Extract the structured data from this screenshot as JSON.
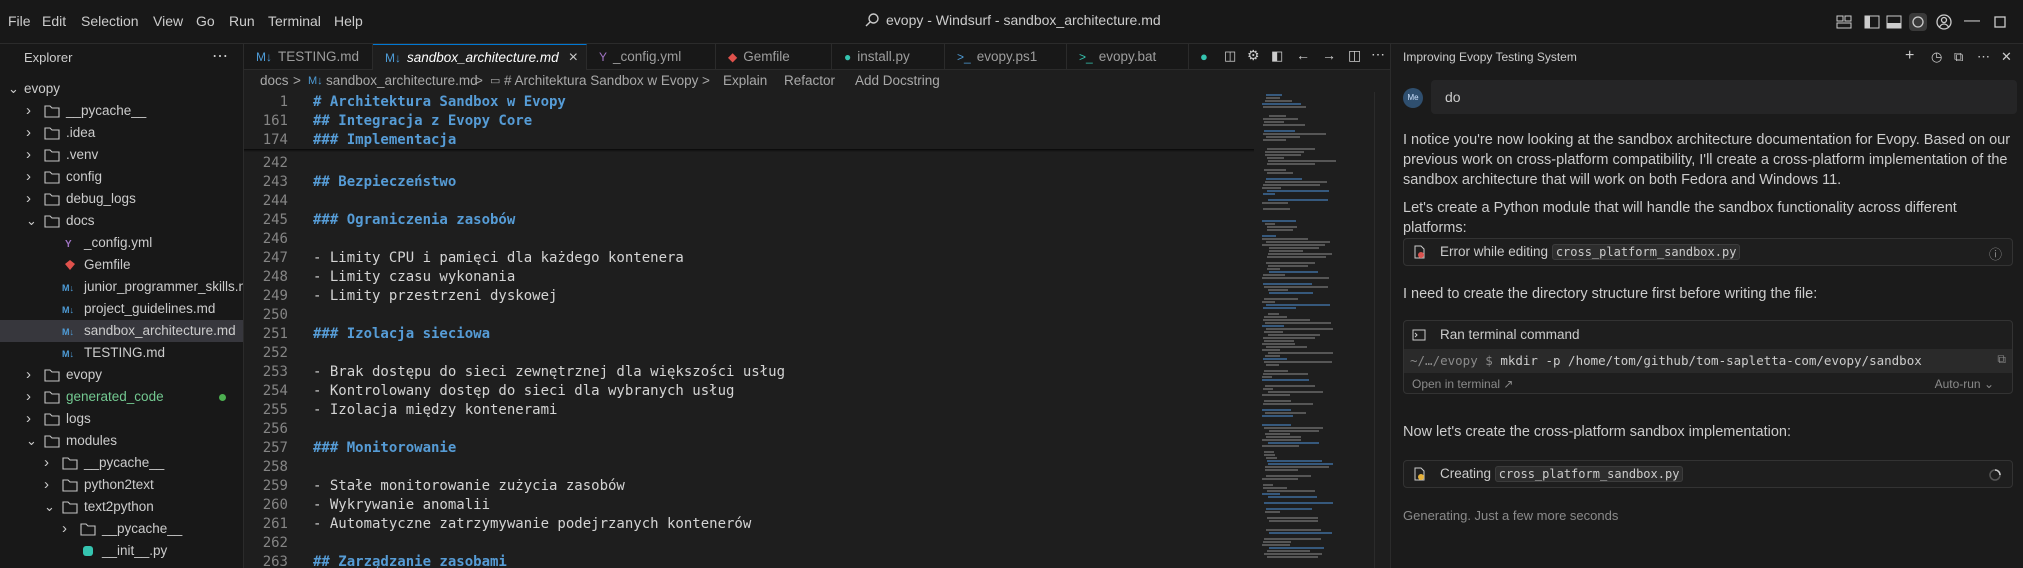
{
  "menu": [
    "File",
    "Edit",
    "Selection",
    "View",
    "Go",
    "Run",
    "Terminal",
    "Help"
  ],
  "window_title": "evopy - Windsurf - sandbox_architecture.md",
  "explorer": {
    "title": "Explorer",
    "tree": [
      {
        "label": "evopy",
        "type": "root"
      },
      {
        "label": "__pycache__",
        "type": "folder"
      },
      {
        "label": ".idea",
        "type": "folder"
      },
      {
        "label": ".venv",
        "type": "folder"
      },
      {
        "label": "config",
        "type": "folder"
      },
      {
        "label": "debug_logs",
        "type": "folder"
      },
      {
        "label": "docs",
        "type": "folder-open"
      },
      {
        "label": "_config.yml",
        "type": "yml"
      },
      {
        "label": "Gemfile",
        "type": "gem"
      },
      {
        "label": "junior_programmer_skills.md",
        "type": "md"
      },
      {
        "label": "project_guidelines.md",
        "type": "md"
      },
      {
        "label": "sandbox_architecture.md",
        "type": "md"
      },
      {
        "label": "TESTING.md",
        "type": "md"
      },
      {
        "label": "evopy",
        "type": "folder"
      },
      {
        "label": "generated_code",
        "type": "folder-green"
      },
      {
        "label": "logs",
        "type": "folder"
      },
      {
        "label": "modules",
        "type": "folder-open"
      },
      {
        "label": "__pycache__",
        "type": "folder"
      },
      {
        "label": "python2text",
        "type": "folder"
      },
      {
        "label": "text2python",
        "type": "folder-open"
      },
      {
        "label": "__pycache__",
        "type": "folder"
      },
      {
        "label": "__init__.py",
        "type": "py"
      }
    ]
  },
  "tabs": [
    {
      "label": "TESTING.md",
      "icon": "md"
    },
    {
      "label": "sandbox_architecture.md",
      "icon": "md",
      "close": "×"
    },
    {
      "label": "_config.yml",
      "icon": "yml"
    },
    {
      "label": "Gemfile",
      "icon": "gem"
    },
    {
      "label": "install.py",
      "icon": "py"
    },
    {
      "label": "evopy.ps1",
      "icon": "ps"
    },
    {
      "label": "evopy.bat",
      "icon": "bat"
    }
  ],
  "breadcrumbs": {
    "items": [
      "docs",
      "sandbox_architecture.md",
      "# Architektura Sandbox w Evopy"
    ],
    "actions": [
      "Explain",
      "Refactor",
      "Add Docstring"
    ],
    "sep": ">"
  },
  "editor": {
    "sticky": [
      {
        "n": "1",
        "text": "# Architektura Sandbox w Evopy",
        "kind": "h"
      },
      {
        "n": "161",
        "text": "## Integracja z Evopy Core",
        "kind": "h"
      },
      {
        "n": "174",
        "text": "### Implementacja",
        "kind": "h"
      }
    ],
    "lines": [
      {
        "n": "242",
        "text": "",
        "kind": "t"
      },
      {
        "n": "243",
        "text": "## Bezpieczeństwo",
        "kind": "h"
      },
      {
        "n": "244",
        "text": "",
        "kind": "t"
      },
      {
        "n": "245",
        "text": "### Ograniczenia zasobów",
        "kind": "h"
      },
      {
        "n": "246",
        "text": "",
        "kind": "t"
      },
      {
        "n": "247",
        "text": "- Limity CPU i pamięci dla każdego kontenera",
        "kind": "t"
      },
      {
        "n": "248",
        "text": "- Limity czasu wykonania",
        "kind": "t"
      },
      {
        "n": "249",
        "text": "- Limity przestrzeni dyskowej",
        "kind": "t"
      },
      {
        "n": "250",
        "text": "",
        "kind": "t"
      },
      {
        "n": "251",
        "text": "### Izolacja sieciowa",
        "kind": "h"
      },
      {
        "n": "252",
        "text": "",
        "kind": "t"
      },
      {
        "n": "253",
        "text": "- Brak dostępu do sieci zewnętrznej dla większości usług",
        "kind": "t"
      },
      {
        "n": "254",
        "text": "- Kontrolowany dostęp do sieci dla wybranych usług",
        "kind": "t"
      },
      {
        "n": "255",
        "text": "- Izolacja między kontenerami",
        "kind": "t"
      },
      {
        "n": "256",
        "text": "",
        "kind": "t"
      },
      {
        "n": "257",
        "text": "### Monitorowanie",
        "kind": "h"
      },
      {
        "n": "258",
        "text": "",
        "kind": "t"
      },
      {
        "n": "259",
        "text": "- Stałe monitorowanie zużycia zasobów",
        "kind": "t"
      },
      {
        "n": "260",
        "text": "- Wykrywanie anomalii",
        "kind": "t"
      },
      {
        "n": "261",
        "text": "- Automatyczne zatrzymywanie podejrzanych kontenerów",
        "kind": "t"
      },
      {
        "n": "262",
        "text": "",
        "kind": "t"
      },
      {
        "n": "263",
        "text": "## Zarządzanie zasobami",
        "kind": "h"
      }
    ]
  },
  "chat": {
    "title": "Improving Evopy Testing System",
    "user_avatar": "Me",
    "user_message": "do",
    "p1": "I notice you're now looking at the sandbox architecture documentation for Evopy. Based on our previous work on cross-platform compatibility, I'll create a cross-platform implementation of the sandbox architecture that will work on both Fedora and Windows 11.",
    "p2": "Let's create a Python module that will handle the sandbox functionality across different platforms:",
    "error_card": {
      "text": "Error while editing",
      "file": "cross_platform_sandbox.py"
    },
    "p3": "I need to create the directory structure first before writing the file:",
    "terminal": {
      "title": "Ran terminal command",
      "prompt": "~/…/evopy $",
      "command": "mkdir -p /home/tom/github/tom-sapletta-com/evopy/sandbox",
      "open_label": "Open in terminal",
      "auto_run": "Auto-run"
    },
    "p4": "Now let's create the cross-platform sandbox implementation:",
    "creating_card": {
      "text": "Creating",
      "file": "cross_platform_sandbox.py"
    },
    "generating": "Generating. Just a few more seconds"
  },
  "colors": {
    "accent": "#0078d4",
    "heading": "#569cd6",
    "modified_dot": "#4caf50",
    "md_icon": "#4e9cd7",
    "gem_icon": "#e0524c",
    "py_icon": "#35c4b0",
    "yml_icon": "#a074c4"
  }
}
